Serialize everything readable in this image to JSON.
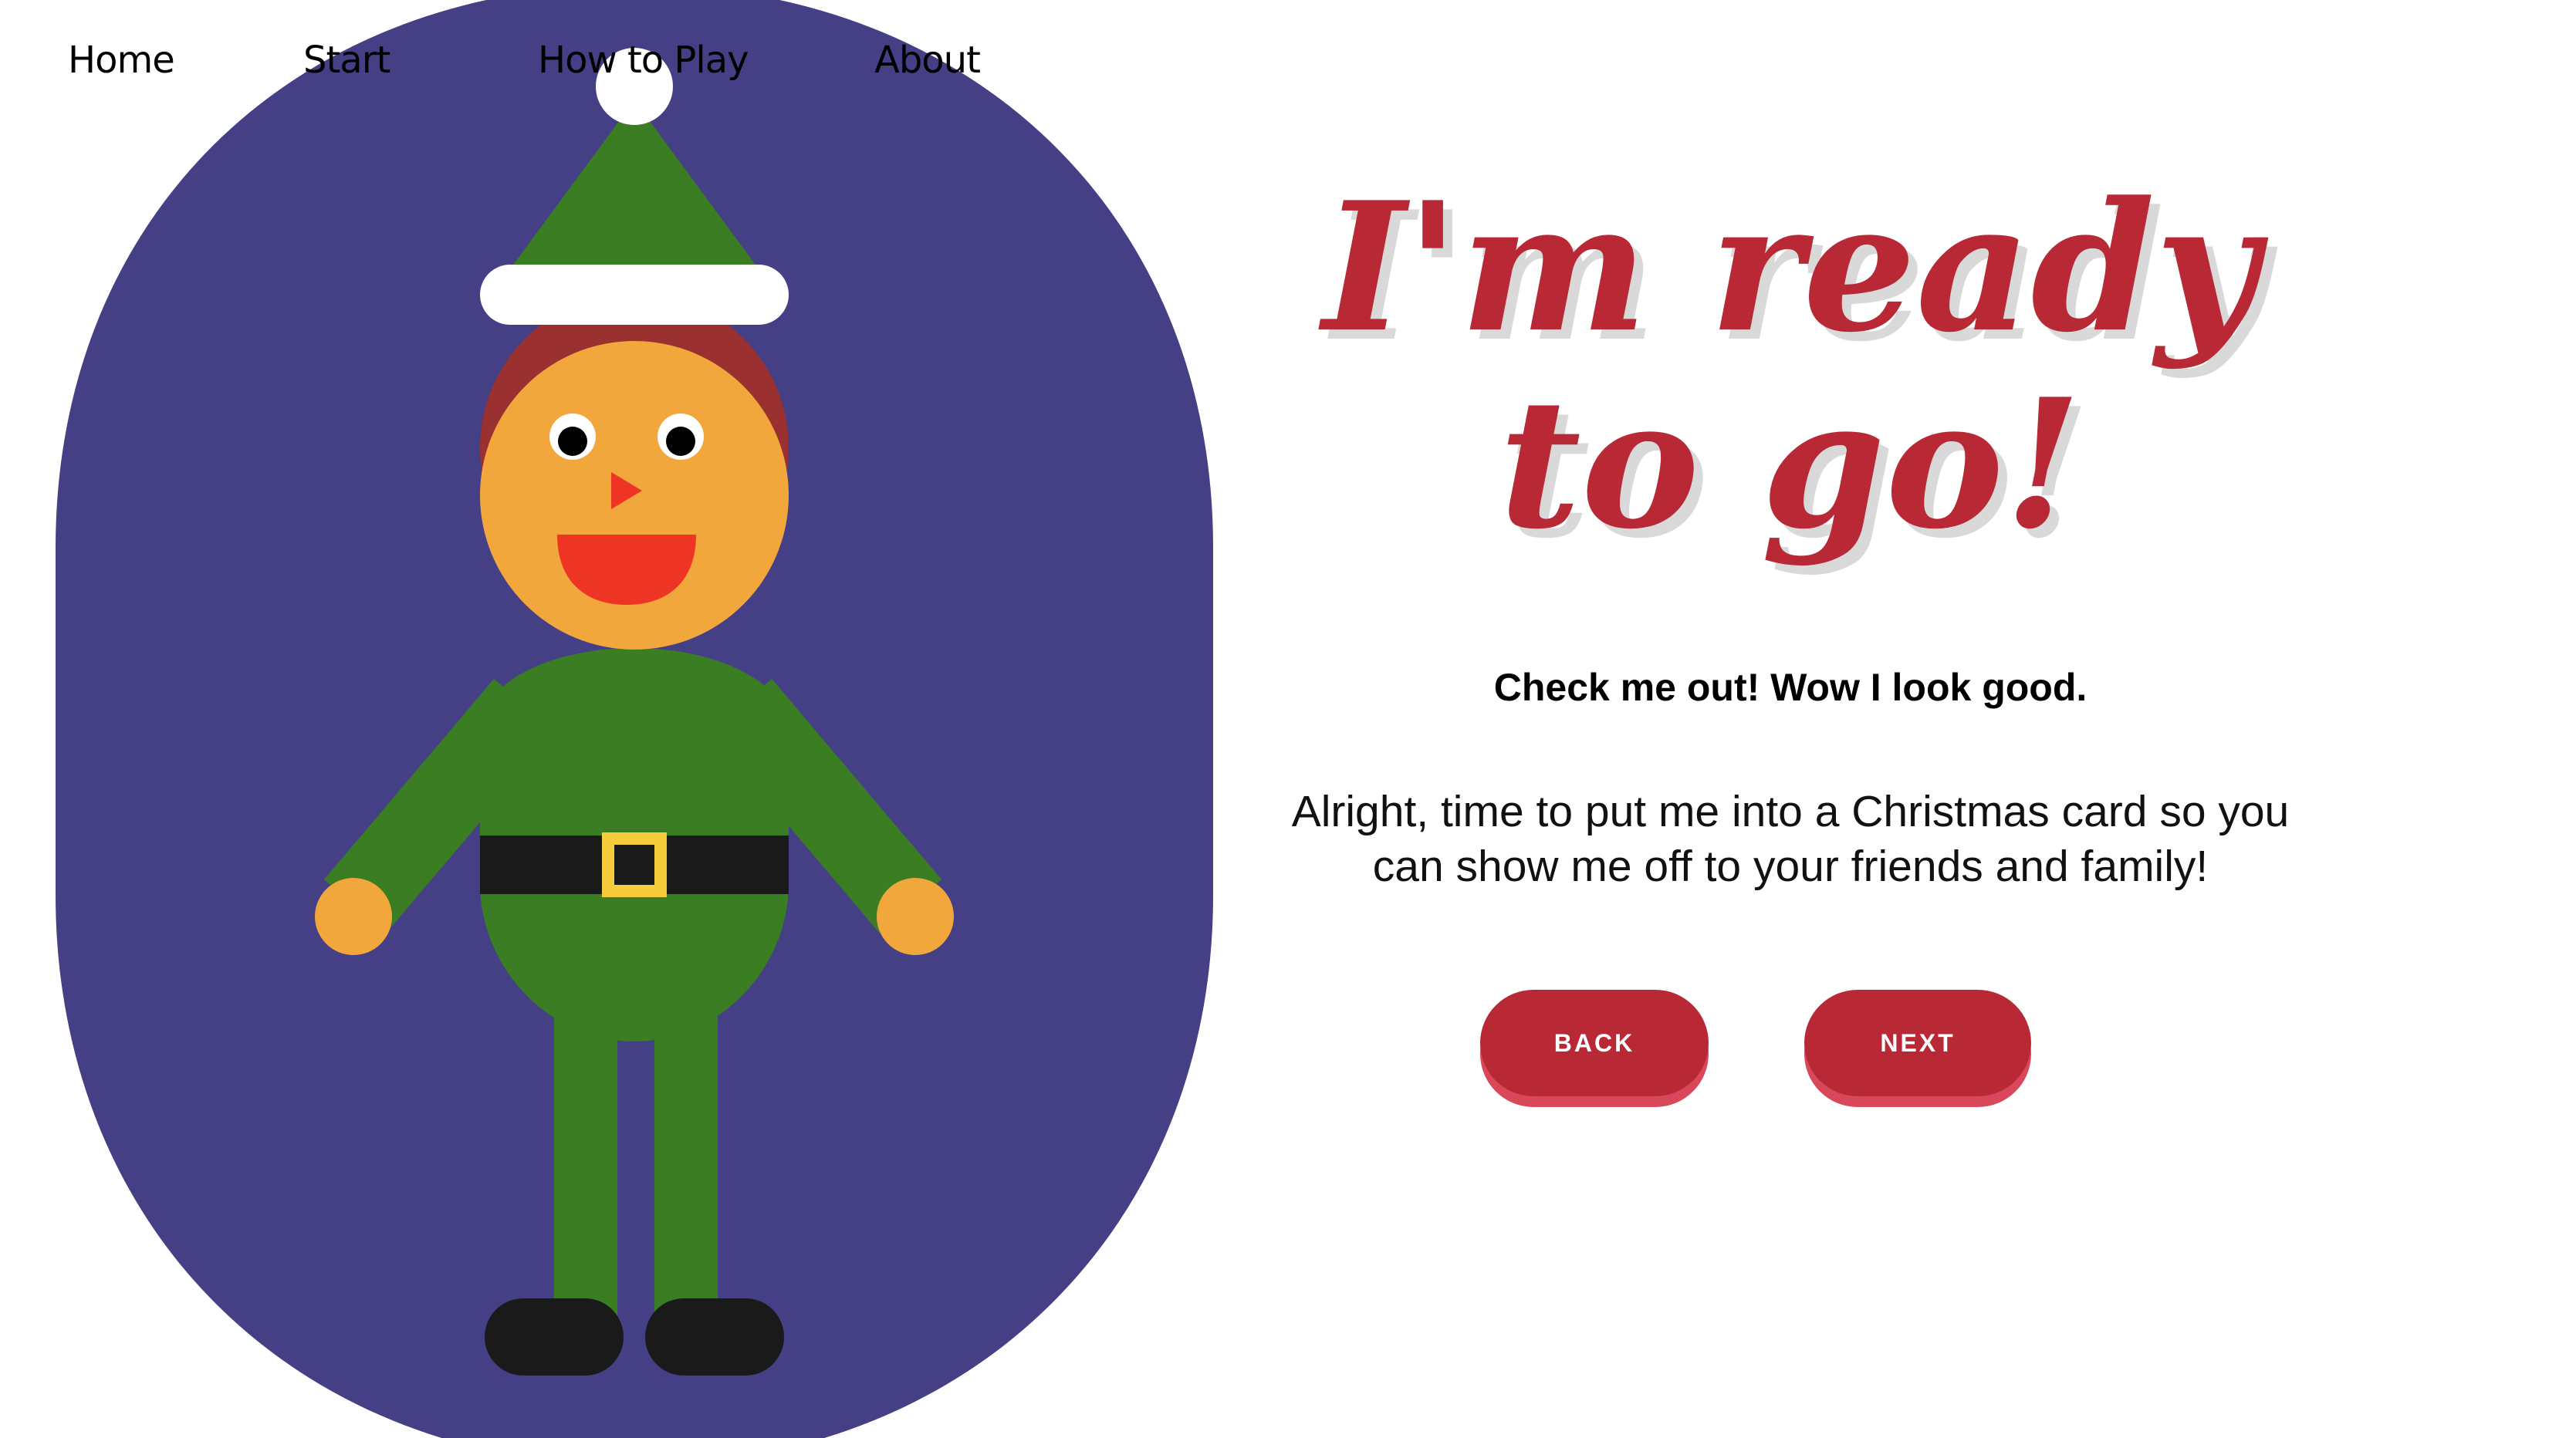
{
  "nav": {
    "home": "Home",
    "start": "Start",
    "how_to_play": "How to Play",
    "about": "About"
  },
  "main": {
    "headline": "I'm ready to go!",
    "subheading": "Check me out! Wow I look good.",
    "body": "Alright, time to put me into a Christmas card so you can show me off to your friends and family!"
  },
  "buttons": {
    "back": "BACK",
    "next": "NEXT"
  },
  "colors": {
    "background_blob": "#453f85",
    "hat": "#3a7d22",
    "hair": "#9b3030",
    "skin": "#f2a73d",
    "mouth": "#ee3524",
    "belt": "#1a1a1a",
    "buckle": "#f5cd3c",
    "accent_red": "#b82935",
    "button_shadow": "#d9485a"
  }
}
